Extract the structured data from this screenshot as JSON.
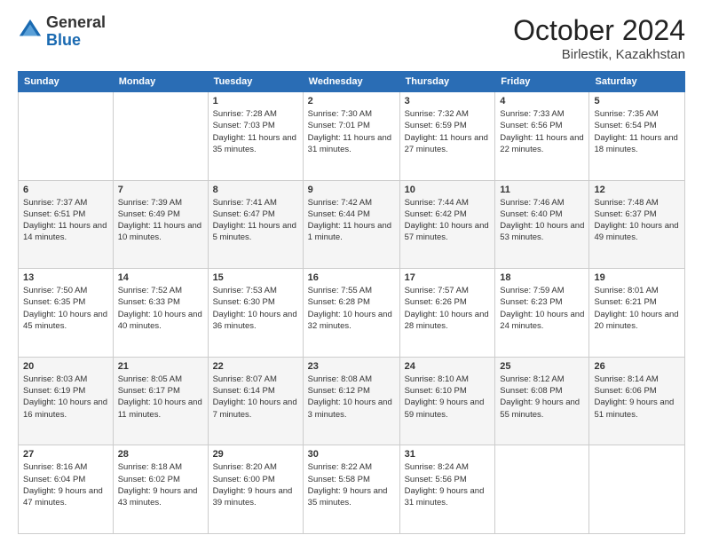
{
  "header": {
    "logo_general": "General",
    "logo_blue": "Blue",
    "month": "October 2024",
    "location": "Birlestik, Kazakhstan"
  },
  "days_of_week": [
    "Sunday",
    "Monday",
    "Tuesday",
    "Wednesday",
    "Thursday",
    "Friday",
    "Saturday"
  ],
  "weeks": [
    [
      {
        "day": "",
        "sunrise": "",
        "sunset": "",
        "daylight": ""
      },
      {
        "day": "",
        "sunrise": "",
        "sunset": "",
        "daylight": ""
      },
      {
        "day": "1",
        "sunrise": "Sunrise: 7:28 AM",
        "sunset": "Sunset: 7:03 PM",
        "daylight": "Daylight: 11 hours and 35 minutes."
      },
      {
        "day": "2",
        "sunrise": "Sunrise: 7:30 AM",
        "sunset": "Sunset: 7:01 PM",
        "daylight": "Daylight: 11 hours and 31 minutes."
      },
      {
        "day": "3",
        "sunrise": "Sunrise: 7:32 AM",
        "sunset": "Sunset: 6:59 PM",
        "daylight": "Daylight: 11 hours and 27 minutes."
      },
      {
        "day": "4",
        "sunrise": "Sunrise: 7:33 AM",
        "sunset": "Sunset: 6:56 PM",
        "daylight": "Daylight: 11 hours and 22 minutes."
      },
      {
        "day": "5",
        "sunrise": "Sunrise: 7:35 AM",
        "sunset": "Sunset: 6:54 PM",
        "daylight": "Daylight: 11 hours and 18 minutes."
      }
    ],
    [
      {
        "day": "6",
        "sunrise": "Sunrise: 7:37 AM",
        "sunset": "Sunset: 6:51 PM",
        "daylight": "Daylight: 11 hours and 14 minutes."
      },
      {
        "day": "7",
        "sunrise": "Sunrise: 7:39 AM",
        "sunset": "Sunset: 6:49 PM",
        "daylight": "Daylight: 11 hours and 10 minutes."
      },
      {
        "day": "8",
        "sunrise": "Sunrise: 7:41 AM",
        "sunset": "Sunset: 6:47 PM",
        "daylight": "Daylight: 11 hours and 5 minutes."
      },
      {
        "day": "9",
        "sunrise": "Sunrise: 7:42 AM",
        "sunset": "Sunset: 6:44 PM",
        "daylight": "Daylight: 11 hours and 1 minute."
      },
      {
        "day": "10",
        "sunrise": "Sunrise: 7:44 AM",
        "sunset": "Sunset: 6:42 PM",
        "daylight": "Daylight: 10 hours and 57 minutes."
      },
      {
        "day": "11",
        "sunrise": "Sunrise: 7:46 AM",
        "sunset": "Sunset: 6:40 PM",
        "daylight": "Daylight: 10 hours and 53 minutes."
      },
      {
        "day": "12",
        "sunrise": "Sunrise: 7:48 AM",
        "sunset": "Sunset: 6:37 PM",
        "daylight": "Daylight: 10 hours and 49 minutes."
      }
    ],
    [
      {
        "day": "13",
        "sunrise": "Sunrise: 7:50 AM",
        "sunset": "Sunset: 6:35 PM",
        "daylight": "Daylight: 10 hours and 45 minutes."
      },
      {
        "day": "14",
        "sunrise": "Sunrise: 7:52 AM",
        "sunset": "Sunset: 6:33 PM",
        "daylight": "Daylight: 10 hours and 40 minutes."
      },
      {
        "day": "15",
        "sunrise": "Sunrise: 7:53 AM",
        "sunset": "Sunset: 6:30 PM",
        "daylight": "Daylight: 10 hours and 36 minutes."
      },
      {
        "day": "16",
        "sunrise": "Sunrise: 7:55 AM",
        "sunset": "Sunset: 6:28 PM",
        "daylight": "Daylight: 10 hours and 32 minutes."
      },
      {
        "day": "17",
        "sunrise": "Sunrise: 7:57 AM",
        "sunset": "Sunset: 6:26 PM",
        "daylight": "Daylight: 10 hours and 28 minutes."
      },
      {
        "day": "18",
        "sunrise": "Sunrise: 7:59 AM",
        "sunset": "Sunset: 6:23 PM",
        "daylight": "Daylight: 10 hours and 24 minutes."
      },
      {
        "day": "19",
        "sunrise": "Sunrise: 8:01 AM",
        "sunset": "Sunset: 6:21 PM",
        "daylight": "Daylight: 10 hours and 20 minutes."
      }
    ],
    [
      {
        "day": "20",
        "sunrise": "Sunrise: 8:03 AM",
        "sunset": "Sunset: 6:19 PM",
        "daylight": "Daylight: 10 hours and 16 minutes."
      },
      {
        "day": "21",
        "sunrise": "Sunrise: 8:05 AM",
        "sunset": "Sunset: 6:17 PM",
        "daylight": "Daylight: 10 hours and 11 minutes."
      },
      {
        "day": "22",
        "sunrise": "Sunrise: 8:07 AM",
        "sunset": "Sunset: 6:14 PM",
        "daylight": "Daylight: 10 hours and 7 minutes."
      },
      {
        "day": "23",
        "sunrise": "Sunrise: 8:08 AM",
        "sunset": "Sunset: 6:12 PM",
        "daylight": "Daylight: 10 hours and 3 minutes."
      },
      {
        "day": "24",
        "sunrise": "Sunrise: 8:10 AM",
        "sunset": "Sunset: 6:10 PM",
        "daylight": "Daylight: 9 hours and 59 minutes."
      },
      {
        "day": "25",
        "sunrise": "Sunrise: 8:12 AM",
        "sunset": "Sunset: 6:08 PM",
        "daylight": "Daylight: 9 hours and 55 minutes."
      },
      {
        "day": "26",
        "sunrise": "Sunrise: 8:14 AM",
        "sunset": "Sunset: 6:06 PM",
        "daylight": "Daylight: 9 hours and 51 minutes."
      }
    ],
    [
      {
        "day": "27",
        "sunrise": "Sunrise: 8:16 AM",
        "sunset": "Sunset: 6:04 PM",
        "daylight": "Daylight: 9 hours and 47 minutes."
      },
      {
        "day": "28",
        "sunrise": "Sunrise: 8:18 AM",
        "sunset": "Sunset: 6:02 PM",
        "daylight": "Daylight: 9 hours and 43 minutes."
      },
      {
        "day": "29",
        "sunrise": "Sunrise: 8:20 AM",
        "sunset": "Sunset: 6:00 PM",
        "daylight": "Daylight: 9 hours and 39 minutes."
      },
      {
        "day": "30",
        "sunrise": "Sunrise: 8:22 AM",
        "sunset": "Sunset: 5:58 PM",
        "daylight": "Daylight: 9 hours and 35 minutes."
      },
      {
        "day": "31",
        "sunrise": "Sunrise: 8:24 AM",
        "sunset": "Sunset: 5:56 PM",
        "daylight": "Daylight: 9 hours and 31 minutes."
      },
      {
        "day": "",
        "sunrise": "",
        "sunset": "",
        "daylight": ""
      },
      {
        "day": "",
        "sunrise": "",
        "sunset": "",
        "daylight": ""
      }
    ]
  ]
}
